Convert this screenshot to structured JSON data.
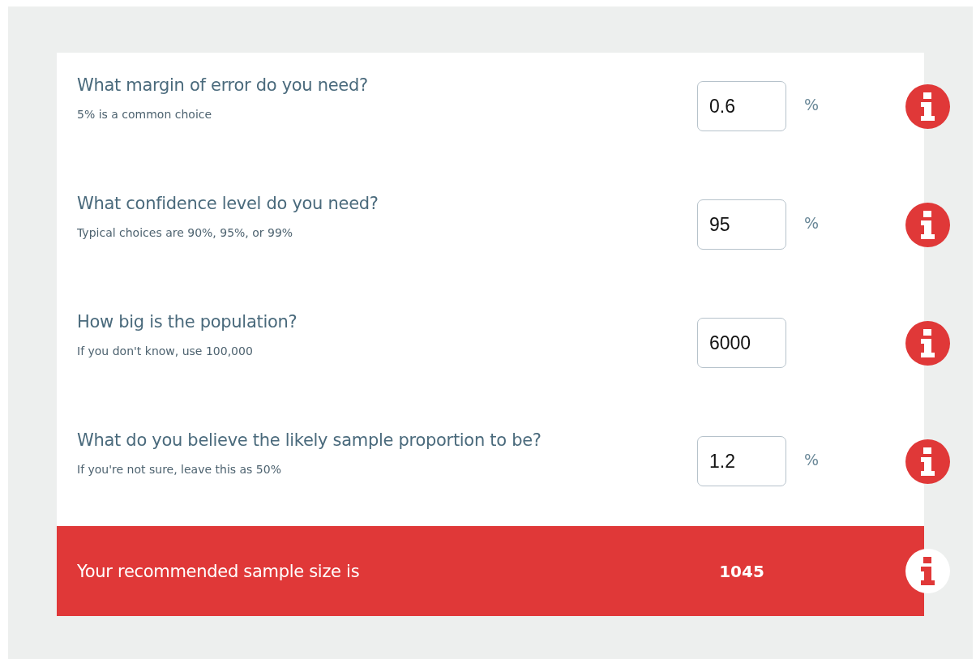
{
  "questions": [
    {
      "title": "What margin of error do you need?",
      "hint": "5% is a common choice",
      "value": "0.6",
      "unit": "%"
    },
    {
      "title": "What confidence level do you need?",
      "hint": "Typical choices are 90%, 95%, or 99%",
      "value": "95",
      "unit": "%"
    },
    {
      "title": "How big is the population?",
      "hint": "If you don't know, use 100,000",
      "value": "6000"
    },
    {
      "title": "What do you believe the likely sample proportion to be?",
      "hint": "If you're not sure, leave this as 50%",
      "value": "1.2",
      "unit": "%"
    }
  ],
  "result": {
    "label": "Your recommended sample size is",
    "value": "1045"
  }
}
